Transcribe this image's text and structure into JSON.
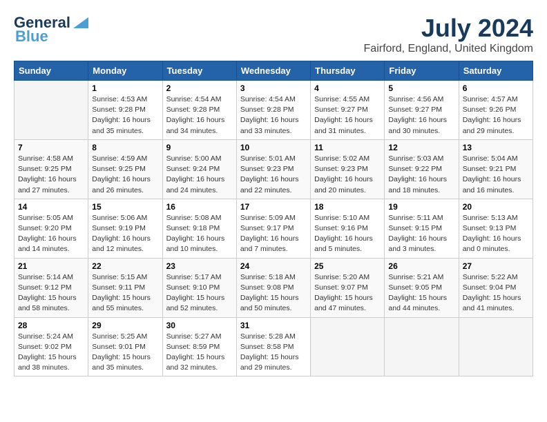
{
  "header": {
    "logo_general": "General",
    "logo_blue": "Blue",
    "month_title": "July 2024",
    "location": "Fairford, England, United Kingdom"
  },
  "days_of_week": [
    "Sunday",
    "Monday",
    "Tuesday",
    "Wednesday",
    "Thursday",
    "Friday",
    "Saturday"
  ],
  "weeks": [
    [
      {
        "day": "",
        "info": ""
      },
      {
        "day": "1",
        "info": "Sunrise: 4:53 AM\nSunset: 9:28 PM\nDaylight: 16 hours\nand 35 minutes."
      },
      {
        "day": "2",
        "info": "Sunrise: 4:54 AM\nSunset: 9:28 PM\nDaylight: 16 hours\nand 34 minutes."
      },
      {
        "day": "3",
        "info": "Sunrise: 4:54 AM\nSunset: 9:28 PM\nDaylight: 16 hours\nand 33 minutes."
      },
      {
        "day": "4",
        "info": "Sunrise: 4:55 AM\nSunset: 9:27 PM\nDaylight: 16 hours\nand 31 minutes."
      },
      {
        "day": "5",
        "info": "Sunrise: 4:56 AM\nSunset: 9:27 PM\nDaylight: 16 hours\nand 30 minutes."
      },
      {
        "day": "6",
        "info": "Sunrise: 4:57 AM\nSunset: 9:26 PM\nDaylight: 16 hours\nand 29 minutes."
      }
    ],
    [
      {
        "day": "7",
        "info": "Sunrise: 4:58 AM\nSunset: 9:25 PM\nDaylight: 16 hours\nand 27 minutes."
      },
      {
        "day": "8",
        "info": "Sunrise: 4:59 AM\nSunset: 9:25 PM\nDaylight: 16 hours\nand 26 minutes."
      },
      {
        "day": "9",
        "info": "Sunrise: 5:00 AM\nSunset: 9:24 PM\nDaylight: 16 hours\nand 24 minutes."
      },
      {
        "day": "10",
        "info": "Sunrise: 5:01 AM\nSunset: 9:23 PM\nDaylight: 16 hours\nand 22 minutes."
      },
      {
        "day": "11",
        "info": "Sunrise: 5:02 AM\nSunset: 9:23 PM\nDaylight: 16 hours\nand 20 minutes."
      },
      {
        "day": "12",
        "info": "Sunrise: 5:03 AM\nSunset: 9:22 PM\nDaylight: 16 hours\nand 18 minutes."
      },
      {
        "day": "13",
        "info": "Sunrise: 5:04 AM\nSunset: 9:21 PM\nDaylight: 16 hours\nand 16 minutes."
      }
    ],
    [
      {
        "day": "14",
        "info": "Sunrise: 5:05 AM\nSunset: 9:20 PM\nDaylight: 16 hours\nand 14 minutes."
      },
      {
        "day": "15",
        "info": "Sunrise: 5:06 AM\nSunset: 9:19 PM\nDaylight: 16 hours\nand 12 minutes."
      },
      {
        "day": "16",
        "info": "Sunrise: 5:08 AM\nSunset: 9:18 PM\nDaylight: 16 hours\nand 10 minutes."
      },
      {
        "day": "17",
        "info": "Sunrise: 5:09 AM\nSunset: 9:17 PM\nDaylight: 16 hours\nand 7 minutes."
      },
      {
        "day": "18",
        "info": "Sunrise: 5:10 AM\nSunset: 9:16 PM\nDaylight: 16 hours\nand 5 minutes."
      },
      {
        "day": "19",
        "info": "Sunrise: 5:11 AM\nSunset: 9:15 PM\nDaylight: 16 hours\nand 3 minutes."
      },
      {
        "day": "20",
        "info": "Sunrise: 5:13 AM\nSunset: 9:13 PM\nDaylight: 16 hours\nand 0 minutes."
      }
    ],
    [
      {
        "day": "21",
        "info": "Sunrise: 5:14 AM\nSunset: 9:12 PM\nDaylight: 15 hours\nand 58 minutes."
      },
      {
        "day": "22",
        "info": "Sunrise: 5:15 AM\nSunset: 9:11 PM\nDaylight: 15 hours\nand 55 minutes."
      },
      {
        "day": "23",
        "info": "Sunrise: 5:17 AM\nSunset: 9:10 PM\nDaylight: 15 hours\nand 52 minutes."
      },
      {
        "day": "24",
        "info": "Sunrise: 5:18 AM\nSunset: 9:08 PM\nDaylight: 15 hours\nand 50 minutes."
      },
      {
        "day": "25",
        "info": "Sunrise: 5:20 AM\nSunset: 9:07 PM\nDaylight: 15 hours\nand 47 minutes."
      },
      {
        "day": "26",
        "info": "Sunrise: 5:21 AM\nSunset: 9:05 PM\nDaylight: 15 hours\nand 44 minutes."
      },
      {
        "day": "27",
        "info": "Sunrise: 5:22 AM\nSunset: 9:04 PM\nDaylight: 15 hours\nand 41 minutes."
      }
    ],
    [
      {
        "day": "28",
        "info": "Sunrise: 5:24 AM\nSunset: 9:02 PM\nDaylight: 15 hours\nand 38 minutes."
      },
      {
        "day": "29",
        "info": "Sunrise: 5:25 AM\nSunset: 9:01 PM\nDaylight: 15 hours\nand 35 minutes."
      },
      {
        "day": "30",
        "info": "Sunrise: 5:27 AM\nSunset: 8:59 PM\nDaylight: 15 hours\nand 32 minutes."
      },
      {
        "day": "31",
        "info": "Sunrise: 5:28 AM\nSunset: 8:58 PM\nDaylight: 15 hours\nand 29 minutes."
      },
      {
        "day": "",
        "info": ""
      },
      {
        "day": "",
        "info": ""
      },
      {
        "day": "",
        "info": ""
      }
    ]
  ]
}
